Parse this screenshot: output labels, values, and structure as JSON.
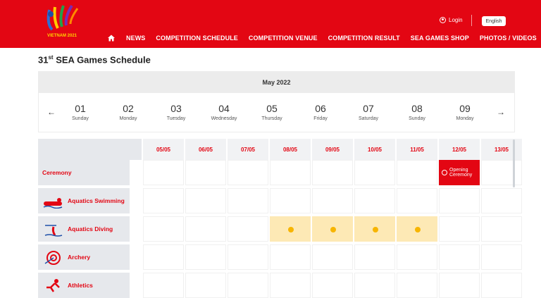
{
  "header": {
    "logo_text": "VIETNAM 2021",
    "login_label": "Login",
    "language": "English",
    "nav": [
      {
        "label": "NEWS"
      },
      {
        "label": "COMPETITION SCHEDULE"
      },
      {
        "label": "COMPETITION VENUE"
      },
      {
        "label": "COMPETITION RESULT"
      },
      {
        "label": "SEA GAMES SHOP"
      },
      {
        "label": "PHOTOS / VIDEOS"
      }
    ]
  },
  "page": {
    "title_pre": "31",
    "title_sup": "st",
    "title_post": " SEA Games Schedule"
  },
  "calendar": {
    "month": "May 2022",
    "prev_icon": "arrow-left-icon",
    "next_icon": "arrow-right-icon",
    "days": [
      {
        "num": "01",
        "dow": "Sunday"
      },
      {
        "num": "02",
        "dow": "Monday"
      },
      {
        "num": "03",
        "dow": "Tuesday"
      },
      {
        "num": "04",
        "dow": "Wednesday"
      },
      {
        "num": "05",
        "dow": "Thursday"
      },
      {
        "num": "06",
        "dow": "Friday"
      },
      {
        "num": "07",
        "dow": "Saturday"
      },
      {
        "num": "08",
        "dow": "Sunday"
      },
      {
        "num": "09",
        "dow": "Monday"
      }
    ]
  },
  "schedule": {
    "dates": [
      "05/05",
      "06/05",
      "07/05",
      "08/05",
      "09/05",
      "10/05",
      "11/05",
      "12/05",
      "13/05"
    ],
    "opening_label_1": "Opening",
    "opening_label_2": "Ceremony",
    "sports": [
      {
        "name": "Ceremony",
        "icon": null,
        "events": []
      },
      {
        "name": "Aquatics Swimming",
        "icon": "swimming-icon",
        "events": []
      },
      {
        "name": "Aquatics Diving",
        "icon": "diving-icon",
        "events": [
          "08/05",
          "09/05",
          "10/05",
          "11/05"
        ]
      },
      {
        "name": "Archery",
        "icon": "archery-icon",
        "events": []
      },
      {
        "name": "Athletics",
        "icon": "athletics-icon",
        "events": []
      }
    ]
  },
  "colors": {
    "brand_red": "#e30613",
    "highlight": "#fde9b5",
    "event_dot": "#f7b500"
  }
}
